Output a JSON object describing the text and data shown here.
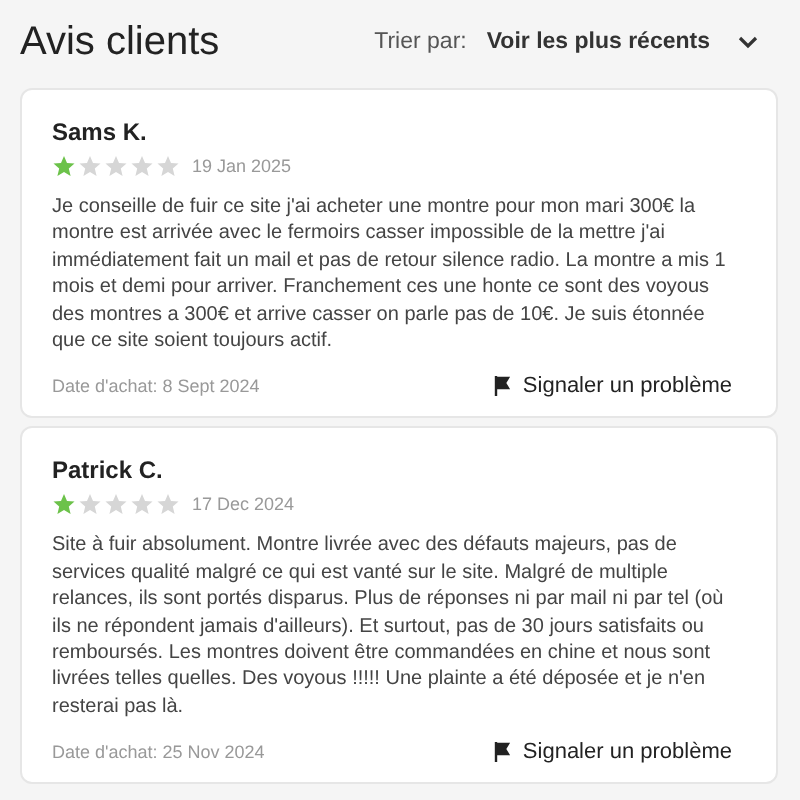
{
  "title": "Avis clients",
  "sort": {
    "label": "Trier par:",
    "value": "Voir les plus récents"
  },
  "reviews": [
    {
      "author": "Sams K.",
      "stars": 1,
      "date": "19 Jan 2025",
      "text": "Je conseille de fuir ce site j'ai acheter une montre pour mon mari 300€ la montre est arrivée avec le fermoirs casser impossible de la mettre j'ai immédiatement fait un mail et pas de retour silence radio. La montre a mis 1 mois et demi pour arriver. Franchement ces une honte ce sont des voyous des montres a 300€ et arrive casser on parle pas de 10€. Je suis étonnée que ce site soient toujours actif.",
      "purchase": "Date d'achat: 8 Sept 2024",
      "report": "Signaler un problème"
    },
    {
      "author": "Patrick C.",
      "stars": 1,
      "date": "17 Dec 2024",
      "text": "Site à fuir absolument. Montre livrée avec des défauts majeurs, pas de services qualité malgré ce qui est vanté sur le site. Malgré de multiple relances, ils sont portés disparus. Plus de réponses ni par mail ni par tel (où ils ne répondent jamais d'ailleurs). Et surtout, pas de 30 jours satisfaits ou remboursés. Les montres doivent être commandées en chine et nous sont livrées telles quelles. Des voyous !!!!! Une plainte a été déposée et je n'en resterai pas là.",
      "purchase": "Date d'achat: 25 Nov 2024",
      "report": "Signaler un problème"
    }
  ]
}
